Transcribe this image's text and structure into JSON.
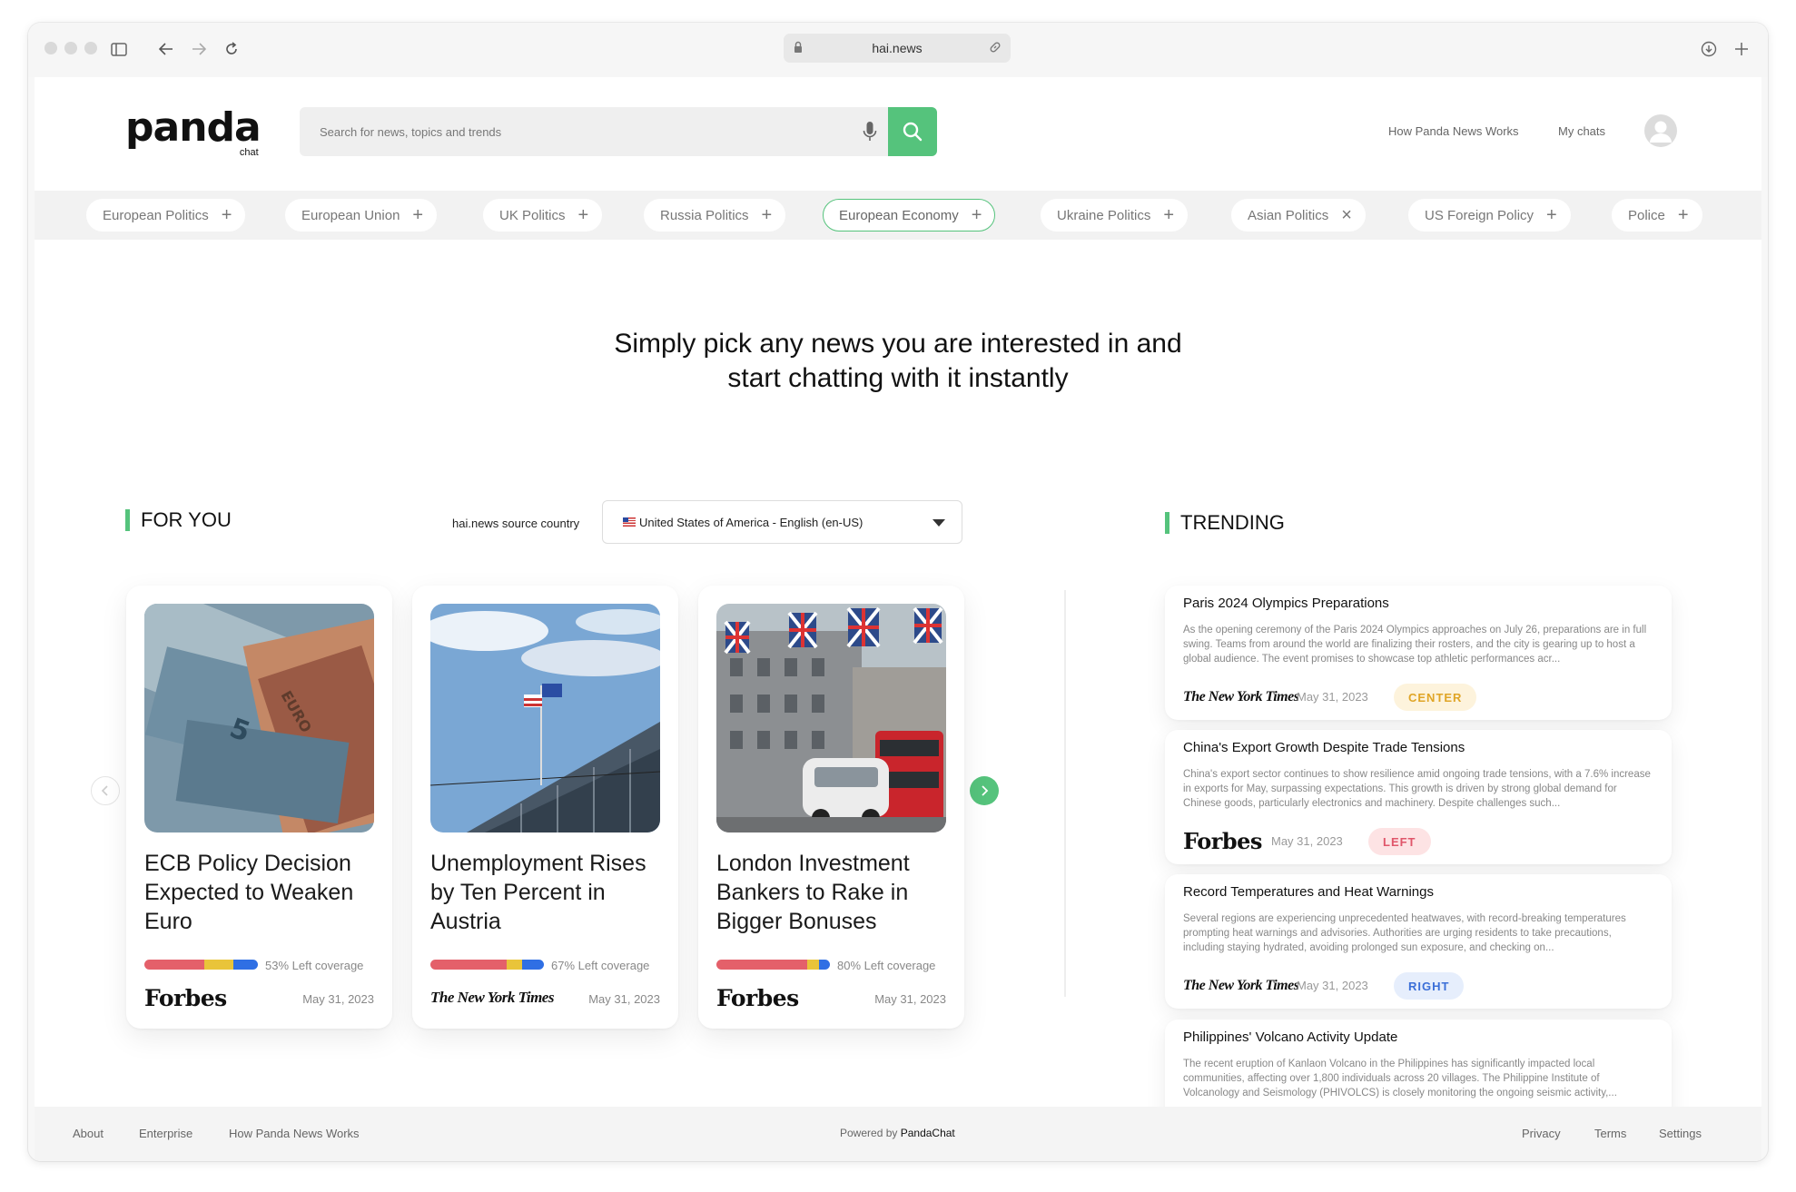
{
  "browser": {
    "url": "hai.news"
  },
  "header": {
    "logo_text": "panda",
    "logo_sub": "chat",
    "search_placeholder": "Search for news, topics and trends",
    "nav": [
      "How Panda News Works",
      "My chats"
    ]
  },
  "tags": [
    {
      "label": "European Politics",
      "icon": "plus-icon",
      "active": false
    },
    {
      "label": "European Union",
      "icon": "plus-icon",
      "active": false
    },
    {
      "label": "UK Politics",
      "icon": "plus-icon",
      "active": false
    },
    {
      "label": "Russia Politics",
      "icon": "plus-icon",
      "active": false
    },
    {
      "label": "European Economy",
      "icon": "plus-icon",
      "active": true
    },
    {
      "label": "Ukraine Politics",
      "icon": "plus-icon",
      "active": false
    },
    {
      "label": "Asian Politics",
      "icon": "close-icon",
      "active": false
    },
    {
      "label": "US Foreign Policy",
      "icon": "plus-icon",
      "active": false
    },
    {
      "label": "Police",
      "icon": "plus-icon",
      "active": false
    }
  ],
  "hero": {
    "line1": "Simply pick any news you are interested in and",
    "line2": "start chatting with it instantly"
  },
  "for_you": {
    "title": "FOR YOU",
    "country_label": "hai.news source country",
    "country_value": "United States of America - English (en-US)",
    "cards": [
      {
        "title": "ECB Policy Decision Expected to Weaken Euro",
        "coverage_text": "53% Left coverage",
        "coverage": {
          "left": 0.53,
          "center": 0.25,
          "right": 0.22
        },
        "source": "Forbes",
        "date": "May 31, 2023"
      },
      {
        "title": "Unemployment Rises by Ten Percent in Austria",
        "coverage_text": "67% Left coverage",
        "coverage": {
          "left": 0.67,
          "center": 0.14,
          "right": 0.19
        },
        "source": "The New York Times",
        "date": "May 31, 2023"
      },
      {
        "title": "London Investment Bankers to Rake in Bigger Bonuses",
        "coverage_text": "80% Left coverage",
        "coverage": {
          "left": 0.8,
          "center": 0.1,
          "right": 0.1
        },
        "source": "Forbes",
        "date": "May 31, 2023"
      }
    ]
  },
  "trending": {
    "title": "TRENDING",
    "items": [
      {
        "title": "Paris 2024 Olympics Preparations",
        "body": "As the opening ceremony of the Paris 2024 Olympics approaches on July 26, preparations are in full swing. Teams from around the world are finalizing their rosters, and the city is gearing up to host a global audience. The event promises to showcase top athletic performances acr...",
        "source": "The New York Times",
        "date": "May 31, 2023",
        "bias": "CENTER"
      },
      {
        "title": "China's Export Growth Despite Trade Tensions",
        "body": "China's export sector continues to show resilience amid ongoing trade tensions, with a 7.6% increase in exports for May, surpassing expectations. This growth is driven by strong global demand for Chinese goods, particularly electronics and machinery. Despite challenges such...",
        "source": "Forbes",
        "date": "May 31, 2023",
        "bias": "LEFT"
      },
      {
        "title": "Record Temperatures and Heat Warnings",
        "body": "Several regions are experiencing unprecedented heatwaves, with record-breaking temperatures prompting heat warnings and advisories. Authorities are urging residents to take precautions, including staying hydrated, avoiding prolonged sun exposure, and checking on...",
        "source": "The New York Times",
        "date": "May 31, 2023",
        "bias": "RIGHT"
      },
      {
        "title": "Philippines' Volcano Activity Update",
        "body": "The recent eruption of Kanlaon Volcano in the Philippines has significantly impacted local communities, affecting over 1,800 individuals across 20 villages. The Philippine Institute of Volcanology and Seismology (PHIVOLCS) is closely monitoring the ongoing seismic activity,..."
      }
    ]
  },
  "footer": {
    "left_links": [
      "About",
      "Enterprise",
      "How Panda News Works"
    ],
    "powered_prefix": "Powered by",
    "powered_brand": "PandaChat",
    "right_links": [
      "Privacy",
      "Terms",
      "Settings"
    ]
  },
  "colors": {
    "accent": "#55c37c",
    "coverage_left": "#e4606a",
    "coverage_center": "#e9c43a",
    "coverage_right": "#2f6fe4",
    "center_badge_bg": "#fdf3dc",
    "center_badge_fg": "#e0a526",
    "left_badge_bg": "#fde3e4",
    "left_badge_fg": "#e0566a",
    "right_badge_bg": "#e6eefc",
    "right_badge_fg": "#3b6fd8"
  }
}
